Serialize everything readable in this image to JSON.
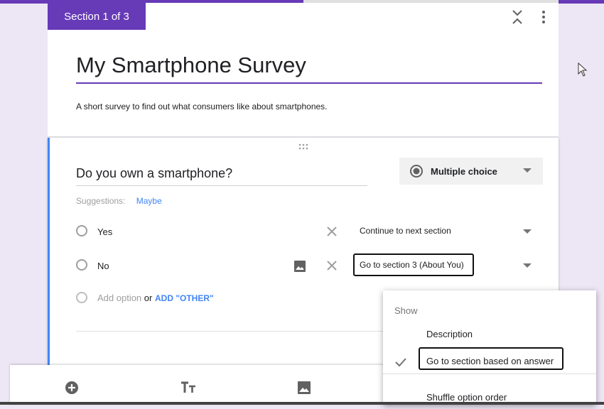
{
  "section": {
    "tab_label": "Section 1 of 3"
  },
  "form": {
    "title": "My Smartphone Survey",
    "description": "A short survey to find out what consumers like about smartphones."
  },
  "question": {
    "text": "Do you own a smartphone?",
    "type_label": "Multiple choice",
    "suggestions_label": "Suggestions:",
    "suggestion_chip": "Maybe",
    "options": [
      {
        "label": "Yes",
        "goto": "Continue to next section"
      },
      {
        "label": "No",
        "goto": "Go to section 3 (About You)"
      }
    ],
    "add_option_label": "Add option",
    "add_option_or": "or",
    "add_other_label": "ADD \"OTHER\""
  },
  "menu": {
    "header": "Show",
    "items": [
      {
        "label": "Description",
        "checked": false
      },
      {
        "label": "Go to section based on answer",
        "checked": true
      },
      {
        "label": "Shuffle option order",
        "checked": false
      }
    ]
  },
  "colors": {
    "accent": "#673ab7",
    "link": "#4285f4",
    "background": "#ede6f5"
  },
  "icons": {
    "header": [
      "collapse-icon",
      "more-vert-icon"
    ],
    "toolbar": [
      "add-question-icon",
      "title-text-icon",
      "add-image-icon"
    ],
    "option_row": [
      "radio-icon",
      "image-icon",
      "remove-icon",
      "dropdown-caret-icon"
    ]
  }
}
